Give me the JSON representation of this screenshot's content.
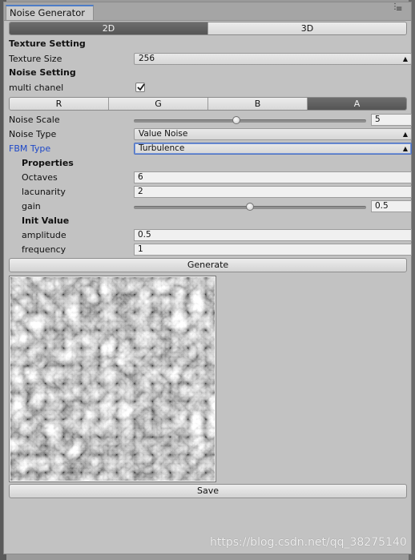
{
  "window": {
    "tab_title": "Noise Generator",
    "menu_icon": "menu-icon",
    "more_icon": "kebab-icon"
  },
  "dimension_toggle": {
    "options": [
      "2D",
      "3D"
    ],
    "selected": "2D"
  },
  "texture_setting": {
    "header": "Texture Setting",
    "texture_size_label": "Texture Size",
    "texture_size_value": "256"
  },
  "noise_setting": {
    "header": "Noise Setting",
    "multi_channel_label": "multi chanel",
    "multi_channel_checked": true,
    "channels": [
      "R",
      "G",
      "B",
      "A"
    ],
    "selected_channel": "A",
    "noise_scale_label": "Noise Scale",
    "noise_scale_value": "5",
    "noise_scale_fraction": 0.44,
    "noise_type_label": "Noise Type",
    "noise_type_value": "Value Noise",
    "fbm_type_label": "FBM Type",
    "fbm_type_value": "Turbulence",
    "fbm_label_color": "#1e48c8"
  },
  "properties": {
    "header": "Properties",
    "octaves_label": "Octaves",
    "octaves_value": "6",
    "lacunarity_label": "lacunarity",
    "lacunarity_value": "2",
    "gain_label": "gain",
    "gain_value": "0.5",
    "gain_fraction": 0.5
  },
  "init_value": {
    "header": "Init Value",
    "amplitude_label": "amplitude",
    "amplitude_value": "0.5",
    "frequency_label": "frequency",
    "frequency_value": "1"
  },
  "buttons": {
    "generate": "Generate",
    "save": "Save"
  },
  "watermark": "https://blog.csdn.net/qq_38275140"
}
